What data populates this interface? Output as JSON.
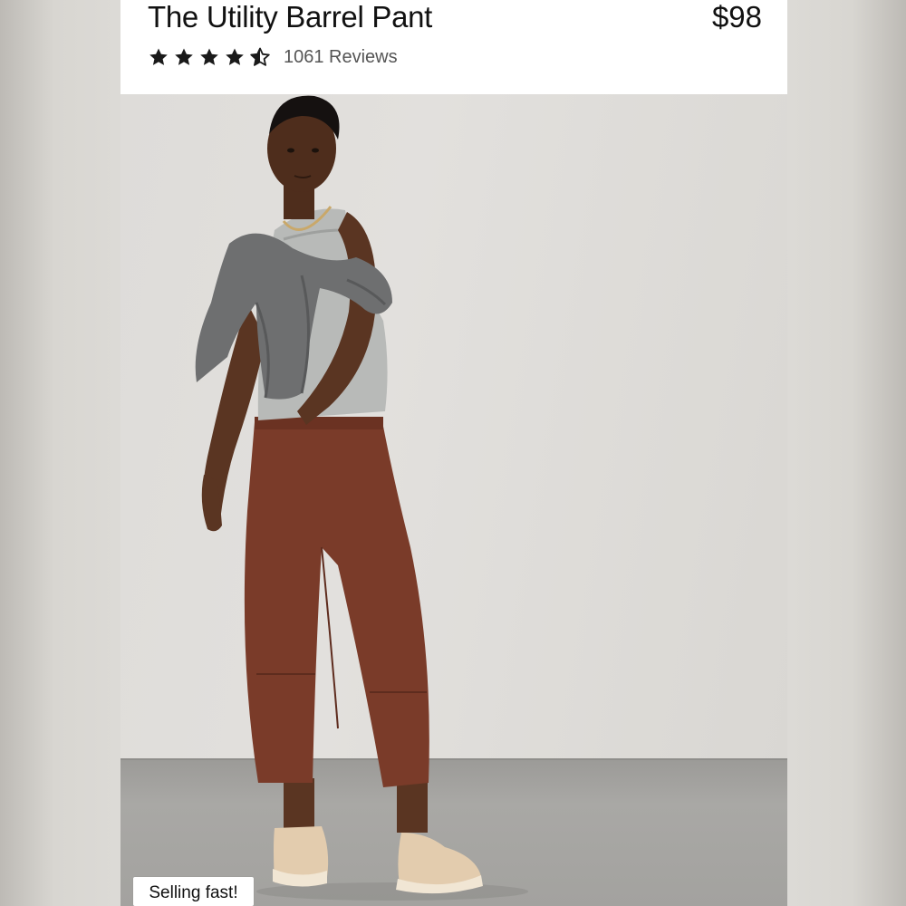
{
  "product": {
    "title": "The Utility Barrel Pant",
    "price": "$98",
    "rating": 4.5,
    "reviews_label": "1061 Reviews"
  },
  "image": {
    "icon": "product-photo-model"
  },
  "badge": {
    "label": "Selling fast!"
  }
}
